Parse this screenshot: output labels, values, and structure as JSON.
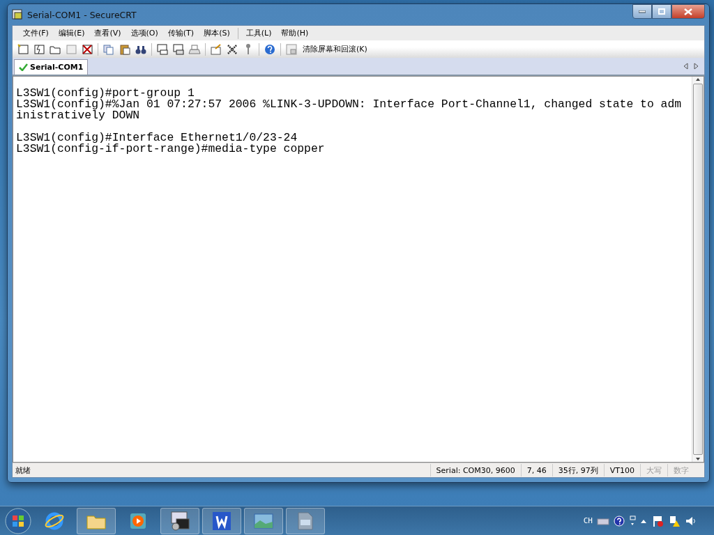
{
  "window": {
    "title": "Serial-COM1 - SecureCRT"
  },
  "menu": [
    "文件(F)",
    "编辑(E)",
    "查看(V)",
    "选项(O)",
    "传输(T)",
    "脚本(S)",
    "工具(L)",
    "帮助(H)"
  ],
  "toolbar": {
    "clear_button": "清除屏幕和回滚(K)"
  },
  "tabs": [
    {
      "label": "Serial-COM1",
      "selected": true,
      "connected": true
    }
  ],
  "terminal": {
    "blocks": [
      [
        "L3SW1(config)#port-group 1",
        "L3SW1(config)#%Jan 01 07:27:57 2006 %LINK-3-UPDOWN: Interface Port-Channel1, changed state to adm",
        "inistratively DOWN"
      ],
      [
        "L3SW1(config)#Interface Ethernet1/0/23-24",
        "L3SW1(config-if-port-range)#media-type copper"
      ]
    ]
  },
  "status_bar": {
    "message": "就绪",
    "panes": [
      {
        "text": "Serial: COM30, 9600",
        "disabled": false
      },
      {
        "text": "7,  46",
        "disabled": false
      },
      {
        "text": "35行, 97列",
        "disabled": false
      },
      {
        "text": "VT100",
        "disabled": false
      },
      {
        "text": "大写",
        "disabled": true
      },
      {
        "text": "数字",
        "disabled": true
      }
    ]
  },
  "taskbar": {
    "language": "CH"
  }
}
